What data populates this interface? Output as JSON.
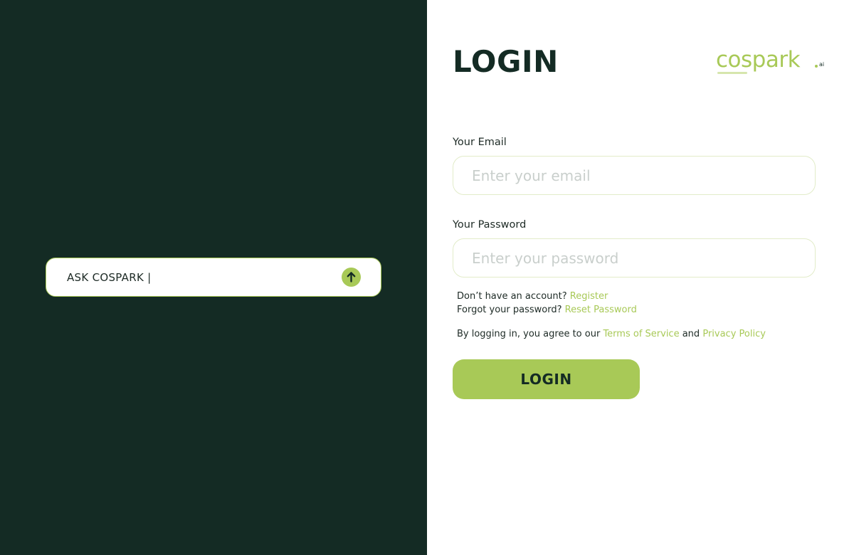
{
  "ask": {
    "text": "ASK COSPARK |",
    "send_icon": "arrow-up-icon"
  },
  "login": {
    "title": "LOGIN",
    "logo": {
      "word": "cospark",
      "suffix": "ai"
    },
    "email": {
      "label": "Your Email",
      "placeholder": "Enter your email",
      "value": ""
    },
    "password": {
      "label": "Your Password",
      "placeholder": "Enter your password",
      "value": ""
    },
    "register": {
      "prefix": "Don’t have an account?",
      "link": "Register"
    },
    "reset": {
      "prefix": "Forgot your password?",
      "link": "Reset Password"
    },
    "terms": {
      "prefix": "By logging in, you agree to our",
      "terms_link": "Terms of Service",
      "conjunction": "and",
      "privacy_link": "Privacy Policy"
    },
    "button_label": "LOGIN"
  },
  "colors": {
    "dark_green": "#142b24",
    "accent_lime": "#a8c957",
    "input_border": "#e2ecc9"
  }
}
